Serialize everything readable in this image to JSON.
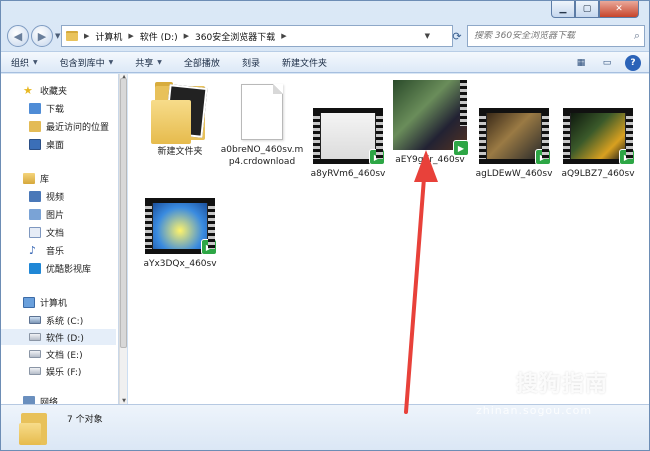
{
  "address": {
    "crumbs": [
      "计算机",
      "软件 (D:)",
      "360安全浏览器下载"
    ]
  },
  "search": {
    "placeholder": "搜索 360安全浏览器下载"
  },
  "toolbar": {
    "organize": "组织",
    "include_in_library": "包含到库中",
    "share": "共享",
    "play_all": "全部播放",
    "burn": "刻录",
    "new_folder": "新建文件夹"
  },
  "sidebar": {
    "favorites": "收藏夹",
    "downloads": "下载",
    "recent": "最近访问的位置",
    "desktop": "桌面",
    "libraries": "库",
    "videos": "视频",
    "pictures": "图片",
    "documents": "文档",
    "music": "音乐",
    "youku": "优酷影视库",
    "computer": "计算机",
    "drive_c": "系统 (C:)",
    "drive_d": "软件 (D:)",
    "drive_e": "文档 (E:)",
    "drive_f": "娱乐 (F:)",
    "network": "网络"
  },
  "files": [
    {
      "name": "新建文件夹",
      "kind": "folder"
    },
    {
      "name": "a0breNO_460sv.mp4.crdownload",
      "kind": "document"
    },
    {
      "name": "a8yRVm6_460sv",
      "kind": "video"
    },
    {
      "name": "aEY9gKr_460sv",
      "kind": "video"
    },
    {
      "name": "agLDEwW_460sv",
      "kind": "video"
    },
    {
      "name": "aQ9LBZ7_460sv",
      "kind": "video"
    },
    {
      "name": "aYx3DQx_460sv",
      "kind": "video"
    }
  ],
  "status": {
    "count_text": "7 个对象"
  },
  "watermark": {
    "brand": "搜狗指南",
    "url": "zhinan.sogou.com"
  },
  "colors": {
    "arrow": "#e8413a",
    "badge": "#2da645"
  }
}
